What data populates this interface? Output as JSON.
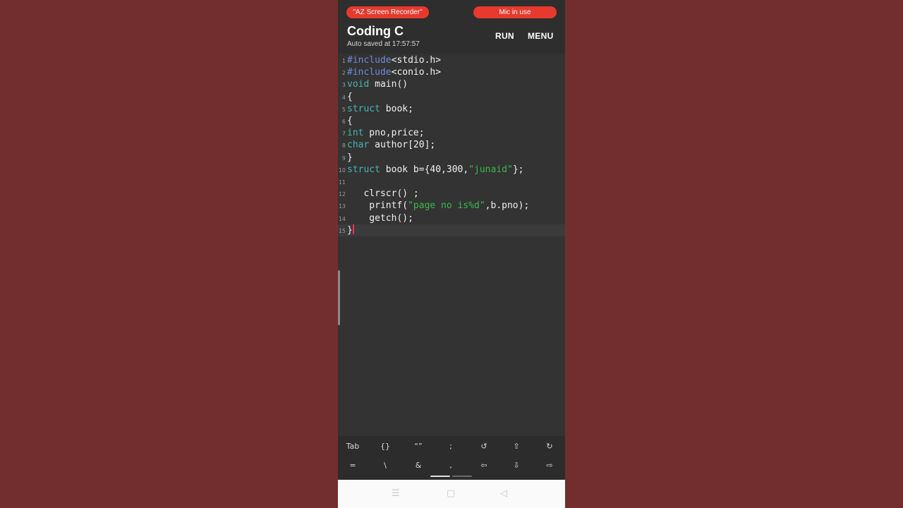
{
  "status_bar": {
    "recorder_label": "\"AZ Screen Recorder\"",
    "mic_label": "Mic in use"
  },
  "header": {
    "title": "Coding C",
    "subtitle": "Auto saved at 17:57:57",
    "run_label": "RUN",
    "menu_label": "MENU"
  },
  "editor": {
    "lines": [
      {
        "n": "1",
        "parts": [
          {
            "t": "#include",
            "c": "kw"
          },
          {
            "t": "<stdio.h>",
            "c": ""
          }
        ]
      },
      {
        "n": "2",
        "parts": [
          {
            "t": "#include",
            "c": "kw"
          },
          {
            "t": "<conio.h>",
            "c": ""
          }
        ]
      },
      {
        "n": "3",
        "parts": [
          {
            "t": "void",
            "c": "ty"
          },
          {
            "t": " main()",
            "c": ""
          }
        ]
      },
      {
        "n": "4",
        "parts": [
          {
            "t": "{",
            "c": ""
          }
        ]
      },
      {
        "n": "5",
        "parts": [
          {
            "t": "struct",
            "c": "ty"
          },
          {
            "t": " book;",
            "c": ""
          }
        ]
      },
      {
        "n": "6",
        "parts": [
          {
            "t": "{",
            "c": ""
          }
        ]
      },
      {
        "n": "7",
        "parts": [
          {
            "t": "int",
            "c": "ty"
          },
          {
            "t": " pno,price;",
            "c": ""
          }
        ]
      },
      {
        "n": "8",
        "parts": [
          {
            "t": "char",
            "c": "ty"
          },
          {
            "t": " author[20];",
            "c": ""
          }
        ]
      },
      {
        "n": "9",
        "parts": [
          {
            "t": "}",
            "c": ""
          }
        ]
      },
      {
        "n": "10",
        "parts": [
          {
            "t": "struct",
            "c": "ty"
          },
          {
            "t": " book b={40,300,",
            "c": ""
          },
          {
            "t": "\"junaid\"",
            "c": "str"
          },
          {
            "t": "};",
            "c": ""
          }
        ]
      },
      {
        "n": "11",
        "parts": []
      },
      {
        "n": "12",
        "parts": [
          {
            "t": "   clrscr() ;",
            "c": ""
          }
        ]
      },
      {
        "n": "13",
        "parts": [
          {
            "t": "    printf(",
            "c": ""
          },
          {
            "t": "\"page no is%d\"",
            "c": "str"
          },
          {
            "t": ",b.pno);",
            "c": ""
          }
        ]
      },
      {
        "n": "14",
        "parts": [
          {
            "t": "    getch();",
            "c": ""
          }
        ]
      },
      {
        "n": "15",
        "parts": [
          {
            "t": "}",
            "c": ""
          }
        ],
        "active": true
      }
    ]
  },
  "keybar": {
    "row1": [
      "Tab",
      "{}",
      "“”",
      ";",
      "↺",
      "⇧",
      "↻"
    ],
    "row2": [
      "=",
      "\\",
      "&",
      ",",
      "⇦",
      "⇩",
      "⇨"
    ],
    "colors": {
      "text": "#d8d8d8",
      "indicator_active": "#e0e0e0",
      "indicator_inactive": "#6a6a6a"
    }
  },
  "navbar": {
    "menu_icon": "☰",
    "home_icon": "▢",
    "back_icon": "◁"
  }
}
